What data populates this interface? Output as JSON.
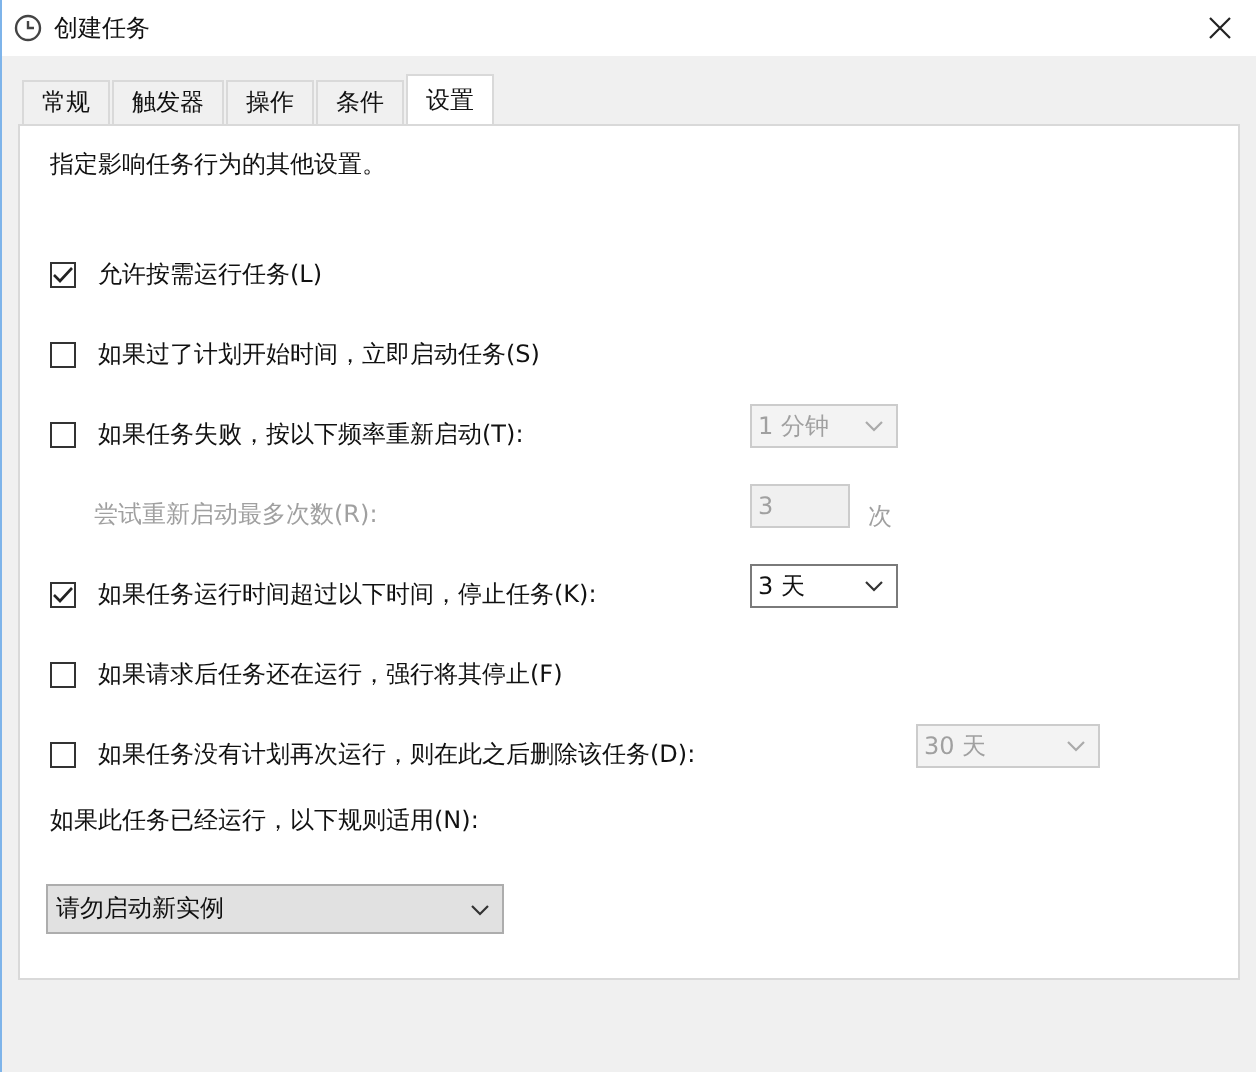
{
  "window": {
    "title": "创建任务"
  },
  "tabs": [
    {
      "label": "常规",
      "selected": false
    },
    {
      "label": "触发器",
      "selected": false
    },
    {
      "label": "操作",
      "selected": false
    },
    {
      "label": "条件",
      "selected": false
    },
    {
      "label": "设置",
      "selected": true
    }
  ],
  "description": "指定影响任务行为的其他设置。",
  "options": [
    {
      "kind": "checkbox",
      "label": "允许按需运行任务(L)",
      "checked": true
    },
    {
      "kind": "checkbox",
      "label": "如果过了计划开始时间，立即启动任务(S)",
      "checked": false
    },
    {
      "kind": "checkbox",
      "label": "如果任务失败，按以下频率重新启动(T):",
      "checked": false,
      "control": {
        "kind": "combo",
        "value": "1 分钟",
        "disabled": true
      }
    },
    {
      "kind": "label",
      "label": "尝试重新启动最多次数(R):",
      "disabled": true,
      "control": {
        "kind": "spin",
        "value": "3",
        "unit": "次",
        "disabled": true
      }
    },
    {
      "kind": "checkbox",
      "label": "如果任务运行时间超过以下时间，停止任务(K):",
      "checked": true,
      "control": {
        "kind": "combo",
        "value": "3 天",
        "disabled": false
      }
    },
    {
      "kind": "checkbox",
      "label": "如果请求后任务还在运行，强行将其停止(F)",
      "checked": false
    },
    {
      "kind": "checkbox",
      "label": "如果任务没有计划再次运行，则在此之后删除该任务(D):",
      "checked": false,
      "control": {
        "kind": "wide-combo",
        "value": "30 天",
        "disabled": true
      }
    }
  ],
  "rule": {
    "label": "如果此任务已经运行，以下规则适用(N):",
    "value": "请勿启动新实例"
  }
}
